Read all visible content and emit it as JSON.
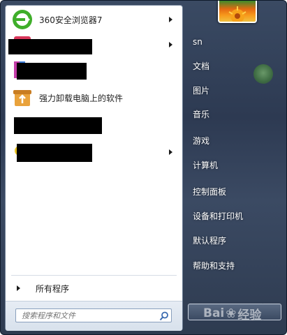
{
  "left_pane": {
    "programs": [
      {
        "label": "360安全浏览器7",
        "icon": "360-browser-icon",
        "has_submenu": true
      },
      {
        "label": "",
        "icon": "redacted-app-icon",
        "has_submenu": true
      },
      {
        "label": "",
        "icon": "redacted-app-icon",
        "has_submenu": false
      },
      {
        "label": "强力卸载电脑上的软件",
        "icon": "uninstaller-icon",
        "has_submenu": false
      },
      {
        "label": "",
        "icon": "redacted-app-icon",
        "has_submenu": false
      },
      {
        "label": "",
        "icon": "redacted-app-icon",
        "has_submenu": true
      }
    ],
    "all_programs_label": "所有程序",
    "search_placeholder": "搜索程序和文件"
  },
  "right_pane": {
    "user_name": "sn",
    "items": [
      {
        "label": "文档"
      },
      {
        "label": "图片"
      },
      {
        "label": "音乐"
      },
      {
        "label": "游戏"
      },
      {
        "label": "计算机"
      },
      {
        "label": "控制面板"
      },
      {
        "label": "设备和打印机"
      },
      {
        "label": "默认程序"
      },
      {
        "label": "帮助和支持"
      }
    ]
  },
  "watermark": {
    "text_left": "Bai",
    "text_right": "经验"
  },
  "colors": {
    "menu_background": "#2d3a52",
    "left_pane_background": "#ffffff",
    "right_text": "#ffffff",
    "redaction": "#000000"
  }
}
